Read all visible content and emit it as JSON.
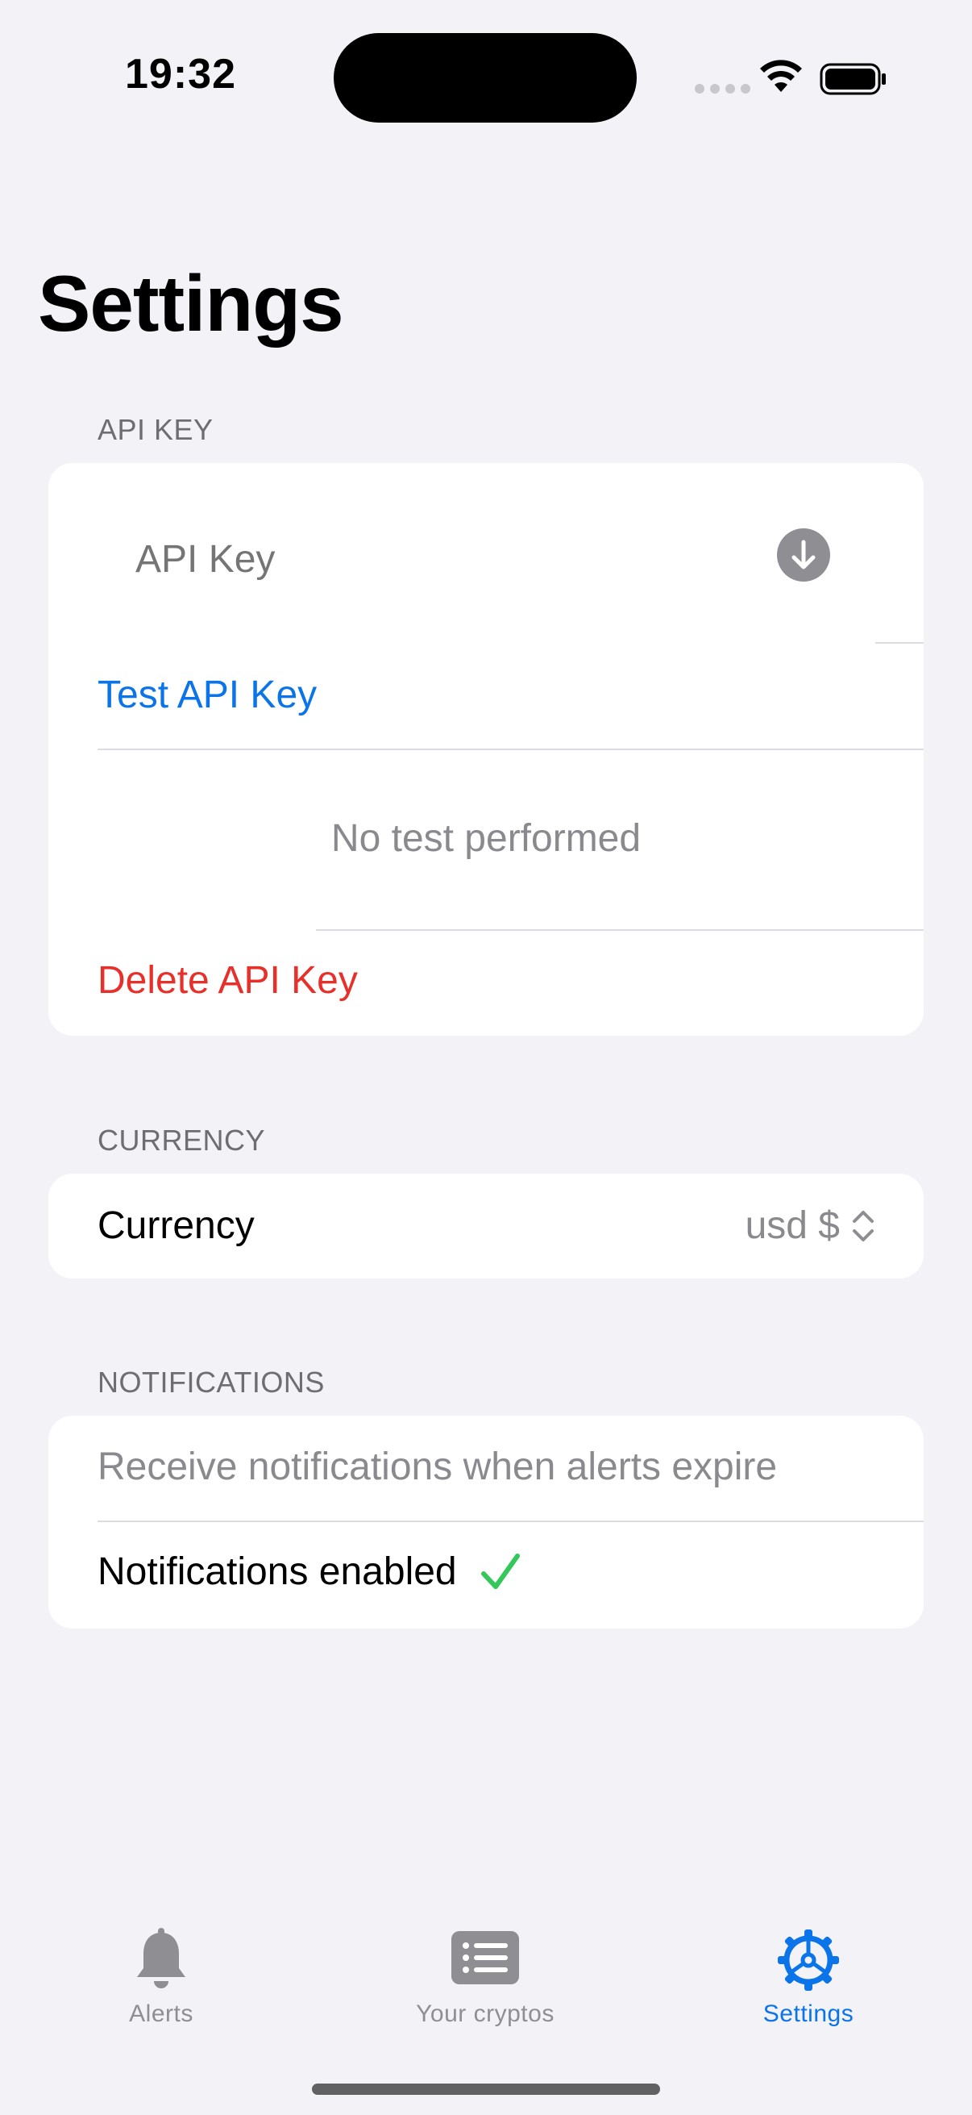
{
  "status_bar": {
    "time": "19:32"
  },
  "page": {
    "title": "Settings"
  },
  "api_key_section": {
    "header": "API KEY",
    "input_placeholder": "API Key",
    "input_value": "",
    "test_button": "Test API Key",
    "test_status": "No test performed",
    "delete_button": "Delete API Key"
  },
  "currency_section": {
    "header": "CURRENCY",
    "label": "Currency",
    "selected_value": "usd $"
  },
  "notifications_section": {
    "header": "NOTIFICATIONS",
    "description": "Receive notifications when alerts expire",
    "status": "Notifications enabled"
  },
  "tab_bar": {
    "tabs": [
      {
        "label": "Alerts",
        "icon": "bell-icon",
        "active": false
      },
      {
        "label": "Your cryptos",
        "icon": "list-icon",
        "active": false
      },
      {
        "label": "Settings",
        "icon": "gear-icon",
        "active": true
      }
    ]
  },
  "colors": {
    "accent": "#0a74e8",
    "destructive": "#e8302b",
    "success": "#34c759",
    "background": "#f2f2f7"
  }
}
